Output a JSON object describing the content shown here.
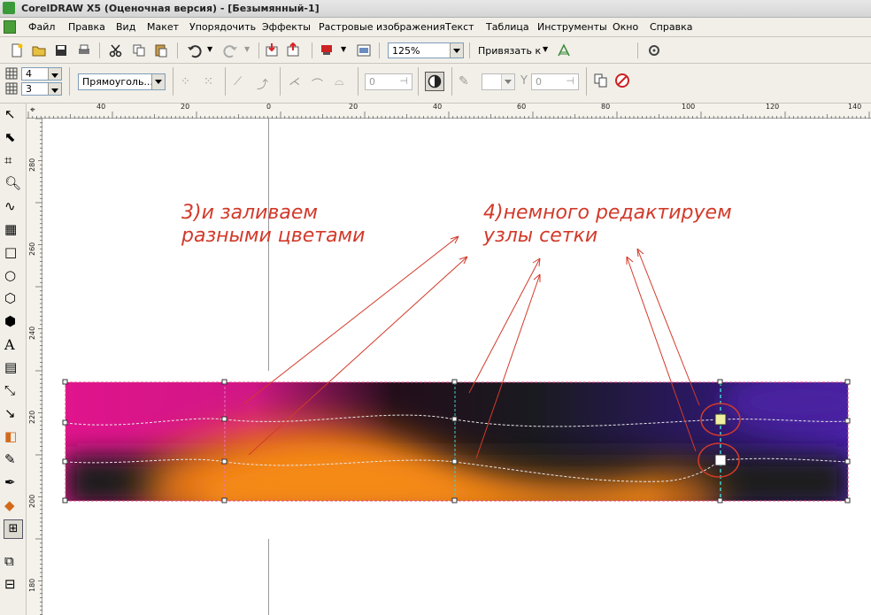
{
  "window": {
    "title": "CorelDRAW X5 (Оценочная версия) - [Безымянный-1]"
  },
  "menu": [
    "Файл",
    "Правка",
    "Вид",
    "Макет",
    "Упорядочить",
    "Эффекты",
    "Растровые изображения",
    "Текст",
    "Таблица",
    "Инструменты",
    "Окно",
    "Справка"
  ],
  "toolbar": {
    "zoom_value": "125%",
    "snap_label": "Привязать к"
  },
  "property_bar": {
    "rows_value": "4",
    "cols_value": "3",
    "selection_mode": "Прямоуголь...",
    "smooth_value": "0",
    "transparency_value": "0"
  },
  "ruler": {
    "h_labels": [
      "40",
      "20",
      "0",
      "20",
      "40",
      "60",
      "80",
      "100",
      "120",
      "140"
    ],
    "v_labels": [
      "280",
      "260",
      "240",
      "220",
      "200",
      "180"
    ]
  },
  "annotations": {
    "fill_note_line1": "3)и заливаем",
    "fill_note_line2": "разными цветами",
    "edit_note_line1": "4)немного редактируем",
    "edit_note_line2": "узлы сетки"
  },
  "colors": {
    "magenta": "#e0148c",
    "orange": "#f07a12",
    "dark": "#1e1e1e",
    "violet": "#4a20a0",
    "note_red": "#d23a2a"
  }
}
